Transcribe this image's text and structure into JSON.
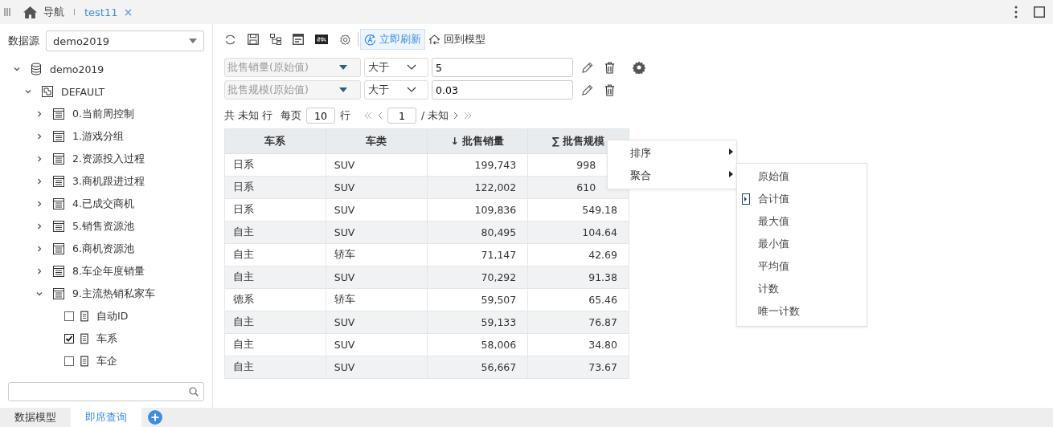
{
  "top_bar": {
    "nav_label": "导航",
    "tab": {
      "label": "test11",
      "selected": true
    }
  },
  "sidebar": {
    "datasource_label": "数据源",
    "datasource": "demo2019",
    "tree": [
      {
        "label": "demo2019",
        "kind": "database",
        "expanded": true,
        "children": [
          {
            "label": "DEFAULT",
            "kind": "schema",
            "expanded": true,
            "children": [
              {
                "label": "0.当前周控制",
                "kind": "table",
                "expanded": false
              },
              {
                "label": "1.游戏分组",
                "kind": "table",
                "expanded": false
              },
              {
                "label": "2.资源投入过程",
                "kind": "table",
                "expanded": false
              },
              {
                "label": "3.商机跟进过程",
                "kind": "table",
                "expanded": false
              },
              {
                "label": "4.已成交商机",
                "kind": "table",
                "expanded": false
              },
              {
                "label": "5.销售资源池",
                "kind": "table",
                "expanded": false
              },
              {
                "label": "6.商机资源池",
                "kind": "table",
                "expanded": false
              },
              {
                "label": "8.车企年度销量",
                "kind": "table",
                "expanded": false
              },
              {
                "label": "9.主流热销私家车",
                "kind": "table",
                "expanded": true,
                "children": [
                  {
                    "label": "自动ID",
                    "kind": "field",
                    "checked": false
                  },
                  {
                    "label": "车系",
                    "kind": "field",
                    "checked": true
                  },
                  {
                    "label": "车企",
                    "kind": "field",
                    "checked": false
                  }
                ]
              }
            ]
          }
        ]
      }
    ]
  },
  "bottom_tabs": [
    {
      "label": "数据模型",
      "selected": false
    },
    {
      "label": "即席查询",
      "selected": true
    }
  ],
  "toolbar": {
    "refresh_now": {
      "label": "立即刷新",
      "on": true
    },
    "back_label": "回到模型"
  },
  "filters": [
    {
      "field": "批售销量(原始值)",
      "operator": "大于",
      "value": "5",
      "settings": true
    },
    {
      "field": "批售规模(原始值)",
      "operator": "大于",
      "value": "0.03",
      "settings": false
    }
  ],
  "pagination": {
    "total_prefix": "共",
    "total": "未知",
    "total_suffix": "行",
    "per_page_label": "每页",
    "per_page": "10",
    "per_page_suffix": "行",
    "page": "1",
    "page_total": "/ 未知"
  },
  "table": {
    "columns": [
      {
        "label": "车系",
        "numeric": false
      },
      {
        "label": "车类",
        "numeric": false
      },
      {
        "label": "批售销量",
        "prefix": "↓",
        "numeric": true
      },
      {
        "label": "批售规模",
        "prefix": "∑",
        "numeric": true
      }
    ],
    "rows": [
      {
        "cells": [
          "日系",
          "SUV",
          "199,743",
          "998"
        ],
        "covered": true
      },
      {
        "cells": [
          "日系",
          "SUV",
          "122,002",
          "610"
        ],
        "covered": true
      },
      {
        "cells": [
          "日系",
          "SUV",
          "109,836",
          "549.18"
        ],
        "covered": false
      },
      {
        "cells": [
          "自主",
          "SUV",
          "80,495",
          "104.64"
        ],
        "covered": false
      },
      {
        "cells": [
          "自主",
          "轿车",
          "71,147",
          "42.69"
        ],
        "covered": false
      },
      {
        "cells": [
          "自主",
          "SUV",
          "70,292",
          "91.38"
        ],
        "covered": false
      },
      {
        "cells": [
          "德系",
          "轿车",
          "59,507",
          "65.46"
        ],
        "covered": false
      },
      {
        "cells": [
          "自主",
          "SUV",
          "59,133",
          "76.87"
        ],
        "covered": false
      },
      {
        "cells": [
          "自主",
          "SUV",
          "58,006",
          "34.80"
        ],
        "covered": false
      },
      {
        "cells": [
          "自主",
          "SUV",
          "56,667",
          "73.67"
        ],
        "covered": false
      }
    ]
  },
  "context_menu": {
    "items": [
      {
        "label": "排序",
        "has_submenu": true
      },
      {
        "label": "聚合",
        "has_submenu": true
      }
    ]
  },
  "submenu": {
    "items": [
      {
        "label": "原始值",
        "selected": false
      },
      {
        "label": "合计值",
        "selected": true
      },
      {
        "label": "最大值",
        "selected": false
      },
      {
        "label": "最小值",
        "selected": false
      },
      {
        "label": "平均值",
        "selected": false
      },
      {
        "label": "计数",
        "selected": false
      },
      {
        "label": "唯一计数",
        "selected": false
      }
    ]
  }
}
